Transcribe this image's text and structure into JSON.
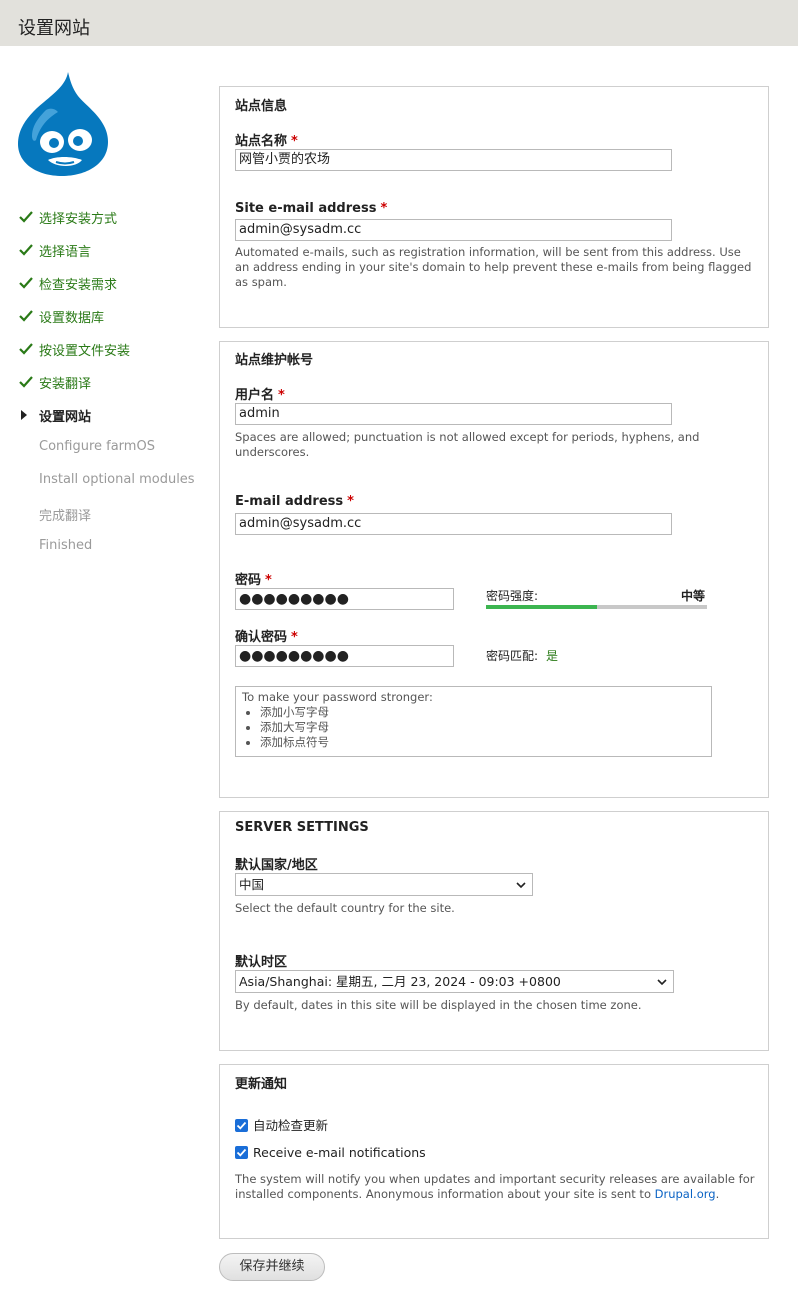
{
  "header": {
    "title": "设置网站"
  },
  "logo": {
    "icon": "drupal-drop-icon",
    "color": "#0678be"
  },
  "steps": [
    {
      "label": "选择安装方式",
      "status": "done"
    },
    {
      "label": "选择语言",
      "status": "done"
    },
    {
      "label": "检查安装需求",
      "status": "done"
    },
    {
      "label": "设置数据库",
      "status": "done"
    },
    {
      "label": "按设置文件安装",
      "status": "done"
    },
    {
      "label": "安装翻译",
      "status": "done"
    },
    {
      "label": "设置网站",
      "status": "current"
    },
    {
      "label": "Configure farmOS",
      "status": "pending"
    },
    {
      "label": "Install optional modules",
      "status": "pending"
    },
    {
      "label": "完成翻译",
      "status": "pending"
    },
    {
      "label": "Finished",
      "status": "pending"
    }
  ],
  "site_info": {
    "legend": "站点信息",
    "site_name_label": "站点名称",
    "site_name_value": "网管小贾的农场",
    "site_email_label": "Site e-mail address",
    "site_email_value": "admin@sysadm.cc",
    "site_email_desc": "Automated e-mails, such as registration information, will be sent from this address. Use an address ending in your site's domain to help prevent these e-mails from being flagged as spam.",
    "required_marker": "*"
  },
  "account": {
    "legend": "站点维护帐号",
    "username_label": "用户名",
    "username_value": "admin",
    "username_desc": "Spaces are allowed; punctuation is not allowed except for periods, hyphens, and underscores.",
    "email_label": "E-mail address",
    "email_value": "admin@sysadm.cc",
    "password_label": "密码",
    "password_value": "●●●●●●●●●",
    "strength_label": "密码强度:",
    "strength_value": "中等",
    "strength_fraction": 0.5,
    "confirm_label": "确认密码",
    "confirm_value": "●●●●●●●●●",
    "match_label": "密码匹配:",
    "match_value": "是",
    "hint_title": "To make your password stronger:",
    "hints": [
      "添加小写字母",
      "添加大写字母",
      "添加标点符号"
    ]
  },
  "server": {
    "legend": "SERVER SETTINGS",
    "country_label": "默认国家/地区",
    "country_value": "中国",
    "country_desc": "Select the default country for the site.",
    "timezone_label": "默认时区",
    "timezone_value": "Asia/Shanghai: 星期五, 二月 23, 2024 - 09:03 +0800",
    "timezone_desc": "By default, dates in this site will be displayed in the chosen time zone."
  },
  "updates": {
    "legend": "更新通知",
    "auto_check_label": "自动检查更新",
    "auto_check_checked": true,
    "email_notify_label": "Receive e-mail notifications",
    "email_notify_checked": true,
    "desc_before_link": "The system will notify you when updates and important security releases are available for installed components. Anonymous information about your site is sent to ",
    "desc_link": "Drupal.org",
    "desc_after_link": "."
  },
  "submit": {
    "label": "保存并继续"
  },
  "colors": {
    "done": "#2a7a17",
    "required": "#cc0000",
    "checkbox": "#1a6ed8",
    "strength": "#3cb550",
    "link": "#0b63c4"
  }
}
